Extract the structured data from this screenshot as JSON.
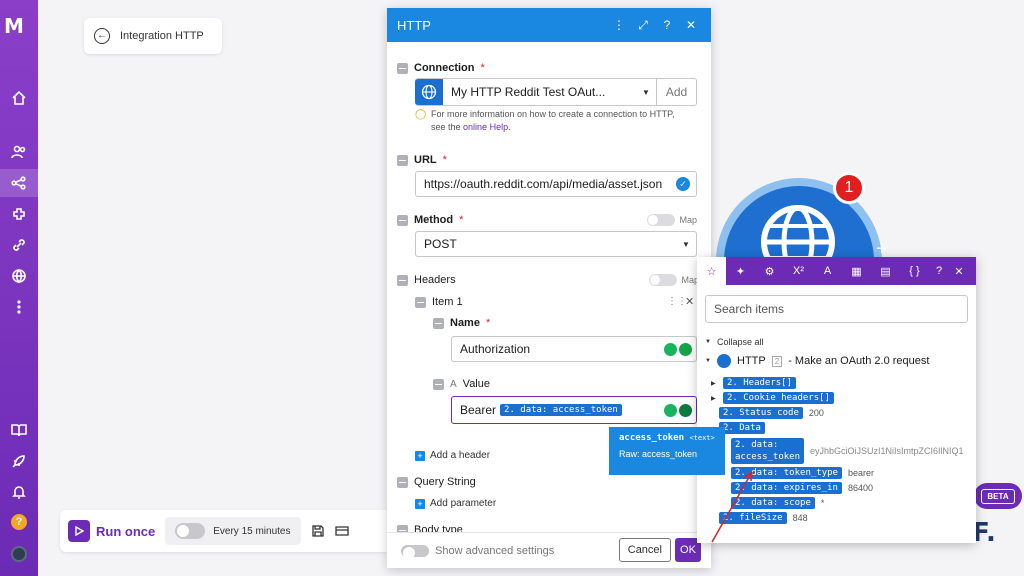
{
  "app": {
    "logo": "M"
  },
  "breadcrumb": {
    "label": "Integration HTTP"
  },
  "node": {
    "badge_count": "1"
  },
  "beta_label": "BETA",
  "watermark": "AF.",
  "bottom_bar": {
    "run_label": "Run once",
    "schedule_label": "Every 15 minutes"
  },
  "panel": {
    "title": "HTTP",
    "connection": {
      "label": "Connection",
      "value": "My HTTP Reddit Test OAut...",
      "add_label": "Add",
      "hint_prefix": "For more information on how to create a connection to HTTP,",
      "hint_see": "see the",
      "hint_link": "online Help",
      "hint_end": "."
    },
    "url": {
      "label": "URL",
      "value": "https://oauth.reddit.com/api/media/asset.json"
    },
    "method": {
      "label": "Method",
      "value": "POST",
      "map_label": "Map"
    },
    "headers": {
      "label": "Headers",
      "map_label": "Map",
      "item_label": "Item 1",
      "name_label": "Name",
      "name_value": "Authorization",
      "value_label": "Value",
      "value_prefix": "Bearer",
      "value_pill": "2. data: access_token",
      "add_label": "Add a header"
    },
    "query_string": {
      "label": "Query String",
      "add_label": "Add parameter"
    },
    "body_type": {
      "label": "Body type"
    },
    "footer": {
      "advanced_label": "Show advanced settings",
      "cancel_label": "Cancel",
      "ok_label": "OK"
    }
  },
  "mapper": {
    "search_placeholder": "Search items",
    "collapse_label": "Collapse all",
    "module_label": "HTTP",
    "module_num": "2",
    "module_desc": "- Make an OAuth 2.0 request",
    "items": [
      {
        "label": "2. Headers[]",
        "value": ""
      },
      {
        "label": "2. Cookie headers[]",
        "value": ""
      },
      {
        "label": "2. Status code",
        "value": "200"
      },
      {
        "label": "2. Data",
        "value": ""
      },
      {
        "label": "2. data:",
        "label2": "access_token",
        "value": "eyJhbGciOiJSUzI1NiIsImtpZCI6IlNIQ1"
      },
      {
        "label": "2. data: token_type",
        "value": "bearer"
      },
      {
        "label": "2. data: expires_in",
        "value": "86400"
      },
      {
        "label": "2. data: scope",
        "value": "*"
      },
      {
        "label": "2. fileSize",
        "value": "848"
      }
    ]
  },
  "tooltip": {
    "name": "access_token",
    "type": "<text>",
    "raw": "Raw: access_token"
  },
  "colors": {
    "brand": "#6c2bb5",
    "accent": "#1a88e0",
    "pill": "#1a6fd0"
  }
}
